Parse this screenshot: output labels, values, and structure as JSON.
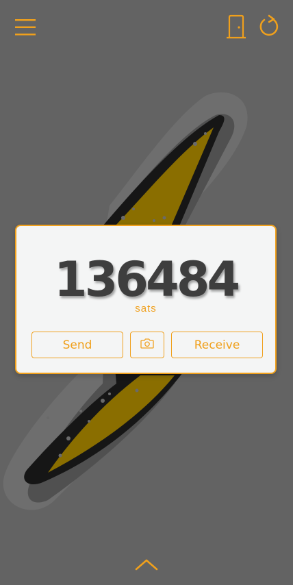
{
  "header": {
    "menu_icon": "hamburger-menu-icon",
    "logout_icon": "door-icon",
    "refresh_icon": "refresh-icon"
  },
  "wallet": {
    "balance": "136484",
    "unit": "sats",
    "send_label": "Send",
    "scan_icon": "camera-icon",
    "receive_label": "Receive"
  },
  "footer": {
    "expand_icon": "chevron-up-icon"
  },
  "colors": {
    "accent": "#f0a01c",
    "background": "#636363",
    "card": "#f4f5f5",
    "balance_text": "#3e3e3e",
    "bolt_fill": "#8a6e00"
  }
}
